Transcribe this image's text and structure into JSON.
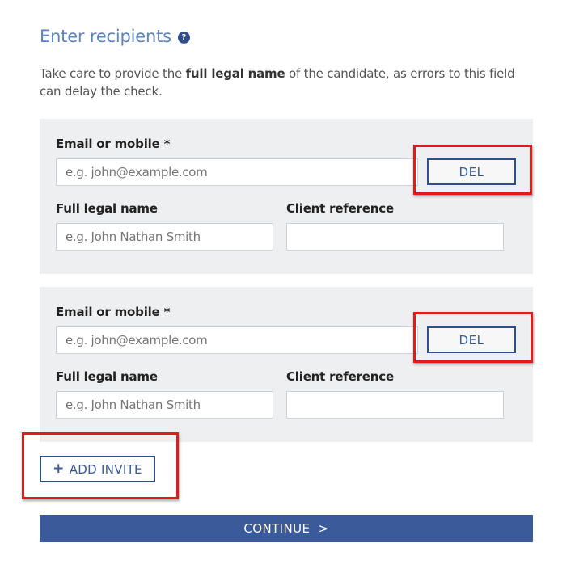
{
  "header": {
    "title": "Enter recipients",
    "help_icon": "?"
  },
  "intro": {
    "before": "Take care to provide the ",
    "bold": "full legal name",
    "after": " of the candidate, as errors to this field can delay the check."
  },
  "recipients": [
    {
      "email_label": "Email or mobile *",
      "email_placeholder": "e.g. john@example.com",
      "delete_label": "DEL",
      "name_label": "Full legal name",
      "name_placeholder": "e.g. John Nathan Smith",
      "reference_label": "Client reference",
      "reference_value": ""
    },
    {
      "email_label": "Email or mobile *",
      "email_placeholder": "e.g. john@example.com",
      "delete_label": "DEL",
      "name_label": "Full legal name",
      "name_placeholder": "e.g. John Nathan Smith",
      "reference_label": "Client reference",
      "reference_value": ""
    }
  ],
  "actions": {
    "add_icon": "+",
    "add_invite_label": "ADD INVITE",
    "continue_label": "CONTINUE  >"
  },
  "colors": {
    "accent": "#3a5a9a",
    "heading": "#5b85c4",
    "highlight": "#e11b1b",
    "card_background": "#eeeff0"
  }
}
